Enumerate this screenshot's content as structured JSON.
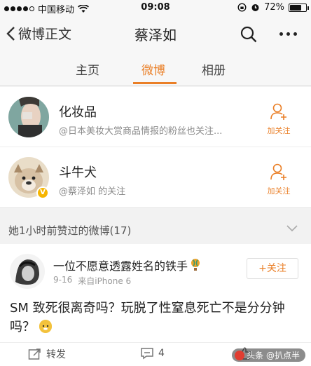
{
  "status_bar": {
    "carrier": "中国移动",
    "time": "09:08",
    "battery_label": "72%",
    "battery_level": 0.72
  },
  "nav": {
    "back_label": "微博正文",
    "title": "蔡泽如"
  },
  "tabs": [
    {
      "label": "主页",
      "active": false
    },
    {
      "label": "微博",
      "active": true
    },
    {
      "label": "相册",
      "active": false
    }
  ],
  "users": [
    {
      "name": "化妆品",
      "desc": "@日本美妆大赏商品情报的粉丝也关注...",
      "follow_label": "加关注"
    },
    {
      "name": "斗牛犬",
      "desc": "@蔡泽如 的关注",
      "follow_label": "加关注"
    }
  ],
  "section": {
    "title": "她1小时前赞过的微博(17)"
  },
  "post": {
    "author": "一位不愿意透露姓名的铁手",
    "date": "9-16",
    "source": "来自iPhone 6",
    "follow_label": "+关注",
    "text": "SM 致死很离奇吗？玩脱了性窒息死亡不是分分钟吗？"
  },
  "actions": {
    "repost_label": "转发",
    "comment_count": "4"
  },
  "watermark": {
    "text": "头条 @扒点半"
  },
  "colors": {
    "accent": "#ea7f27",
    "background": "#f2f2f2"
  }
}
